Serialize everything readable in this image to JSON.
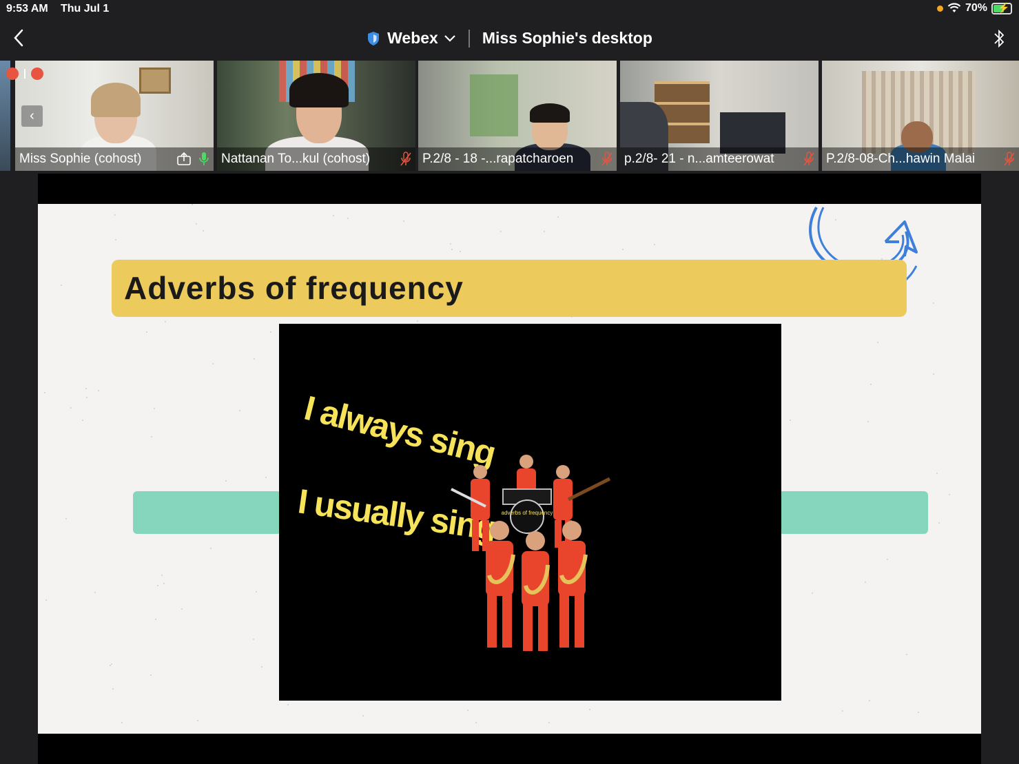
{
  "status_bar": {
    "time": "9:53 AM",
    "date": "Thu Jul 1",
    "battery": "70%",
    "battery_level": 0.7
  },
  "nav": {
    "app_name": "Webex",
    "title": "Miss Sophie's desktop"
  },
  "participants": [
    {
      "name": "Miss Sophie (cohost)",
      "mic": "on",
      "sharing": true
    },
    {
      "name": "Nattanan To...kul (cohost)",
      "mic": "muted"
    },
    {
      "name": "P.2/8 - 18 -...rapatcharoen",
      "mic": "muted"
    },
    {
      "name": "p.2/8- 21 - n...amteerowat",
      "mic": "muted"
    },
    {
      "name": "P.2/8-08-Ch...hawin Malai",
      "mic": "muted"
    }
  ],
  "slide": {
    "title": "Adverbs of frequency",
    "video": {
      "line1": "I always sing",
      "line2": "I usually sing",
      "drum_text": "adverbs of frequency"
    }
  },
  "colors": {
    "title_bar": "#ecca5b",
    "teal_bar": "#86d6bd",
    "arrow": "#3d7fd9",
    "lyrics": "#f6e35a",
    "mic_on": "#4cd964",
    "mic_muted": "#e8543f"
  }
}
